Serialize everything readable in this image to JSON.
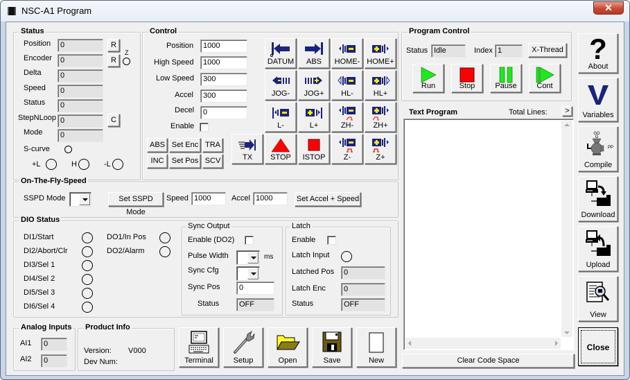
{
  "window": {
    "title": "NSC-A1 Program",
    "close_glyph": "✕"
  },
  "status": {
    "title": "Status",
    "rows": [
      {
        "label": "Position",
        "value": "0",
        "button": "R"
      },
      {
        "label": "Encoder",
        "value": "0",
        "button": "R"
      },
      {
        "label": "Delta",
        "value": "0"
      },
      {
        "label": "Speed",
        "value": "0"
      },
      {
        "label": "Status",
        "value": "0"
      },
      {
        "label": "StepNLoop",
        "value": "0",
        "button": "C"
      },
      {
        "label": "Mode",
        "value": "0"
      }
    ],
    "z_label": "Z",
    "scurve_label": "S-curve",
    "limits": {
      "plus": "+L",
      "home": "H",
      "minus": "-L"
    }
  },
  "control": {
    "title": "Control",
    "fields": [
      {
        "label": "Position",
        "value": "1000"
      },
      {
        "label": "High Speed",
        "value": "1000"
      },
      {
        "label": "Low Speed",
        "value": "300"
      },
      {
        "label": "Accel",
        "value": "300"
      },
      {
        "label": "Decel",
        "value": "0"
      }
    ],
    "enable_label": "Enable",
    "enable_checked": false,
    "small_buttons": [
      "ABS",
      "Set Enc",
      "TRA",
      "INC",
      "Set Pos",
      "SCV"
    ],
    "motion_buttons": [
      {
        "label": "DATUM",
        "icon": "datum-arrow-left-icon"
      },
      {
        "label": "ABS",
        "icon": "abs-arrow-right-icon"
      },
      {
        "label": "HOME-",
        "icon": "home-minus-icon"
      },
      {
        "label": "HOME+",
        "icon": "home-plus-icon"
      },
      {
        "label": "JOG-",
        "icon": "jog-minus-icon"
      },
      {
        "label": "JOG+",
        "icon": "jog-plus-icon"
      },
      {
        "label": "HL-",
        "icon": "hl-minus-icon"
      },
      {
        "label": "HL+",
        "icon": "hl-plus-icon"
      },
      {
        "label": "L-",
        "icon": "limit-minus-icon"
      },
      {
        "label": "L+",
        "icon": "limit-plus-icon"
      },
      {
        "label": "ZH-",
        "icon": "zh-minus-icon"
      },
      {
        "label": "ZH+",
        "icon": "zh-plus-icon"
      },
      {
        "label": "TX",
        "icon": "tx-arrow-icon"
      },
      {
        "label": "STOP",
        "icon": "stop-triangle-icon"
      },
      {
        "label": "ISTOP",
        "icon": "istop-square-icon"
      },
      {
        "label": "Z-",
        "icon": "z-minus-icon"
      },
      {
        "label": "Z+",
        "icon": "z-plus-icon"
      }
    ]
  },
  "program_control": {
    "title": "Program Control",
    "status_label": "Status",
    "status_value": "Idle",
    "index_label": "Index",
    "index_value": "1",
    "xthread_label": "X-Thread",
    "buttons": [
      {
        "label": "Run",
        "icon": "run-icon"
      },
      {
        "label": "Stop",
        "icon": "stop-icon"
      },
      {
        "label": "Pause",
        "icon": "pause-icon"
      },
      {
        "label": "Cont",
        "icon": "continue-icon"
      }
    ]
  },
  "text_program": {
    "title": "Text Program",
    "total_lines_label": "Total Lines:",
    "total_lines_value": "",
    "expand_label": ">",
    "content": "",
    "clear_label": "Clear Code Space"
  },
  "sidebar": {
    "buttons": [
      {
        "label": "About",
        "icon": "question-icon"
      },
      {
        "label": "Variables",
        "icon": "variables-v-icon"
      },
      {
        "label": "Compile",
        "icon": "compile-grinder-icon"
      },
      {
        "label": "Download",
        "icon": "download-icon"
      },
      {
        "label": "Upload",
        "icon": "upload-icon"
      },
      {
        "label": "View",
        "icon": "view-magnifier-icon"
      }
    ],
    "close_label": "Close"
  },
  "on_the_fly": {
    "title": "On-The-Fly-Speed",
    "sspd_mode_label": "SSPD Mode",
    "sspd_mode_value": "",
    "set_sspd_label": "Set SSPD Mode",
    "speed_label": "Speed",
    "speed_value": "1000",
    "accel_label": "Accel",
    "accel_value": "1000",
    "set_accel_speed_label": "Set Accel + Speed"
  },
  "dio": {
    "title": "DIO Status",
    "inputs": [
      "DI1/Start",
      "DI2/Abort/Clr",
      "DI3/Sel 1",
      "DI4/Sel 2",
      "DI5/Sel 3",
      "DI6/Sel 4"
    ],
    "outputs": [
      "DO1/In Pos",
      "DO2/Alarm"
    ],
    "sync_output": {
      "title": "Sync Output",
      "enable_label": "Enable (DO2)",
      "enable_checked": false,
      "pulse_width_label": "Pulse Width",
      "pulse_width_value": "",
      "pulse_unit": "ms",
      "sync_cfg_label": "Sync Cfg",
      "sync_cfg_value": "",
      "sync_pos_label": "Sync Pos",
      "sync_pos_value": "0",
      "status_label": "Status",
      "status_value": "OFF"
    },
    "latch": {
      "title": "Latch",
      "enable_label": "Enable",
      "enable_checked": false,
      "latch_input_label": "Latch Input",
      "latched_pos_label": "Latched Pos",
      "latched_pos_value": "0",
      "latch_enc_label": "Latch Enc",
      "latch_enc_value": "0",
      "status_label": "Status",
      "status_value": "OFF"
    }
  },
  "analog": {
    "title": "Analog Inputs",
    "rows": [
      {
        "label": "AI1",
        "value": "0"
      },
      {
        "label": "AI2",
        "value": "0"
      }
    ]
  },
  "product": {
    "title": "Product Info",
    "version_label": "Version:",
    "version_value": "V000",
    "devnum_label": "Dev Num:",
    "devnum_value": ""
  },
  "bottom_buttons": [
    {
      "label": "Terminal",
      "icon": "terminal-icon"
    },
    {
      "label": "Setup",
      "icon": "wrench-icon"
    },
    {
      "label": "Open",
      "icon": "folder-icon"
    },
    {
      "label": "Save",
      "icon": "floppy-icon"
    },
    {
      "label": "New",
      "icon": "new-document-icon"
    }
  ]
}
